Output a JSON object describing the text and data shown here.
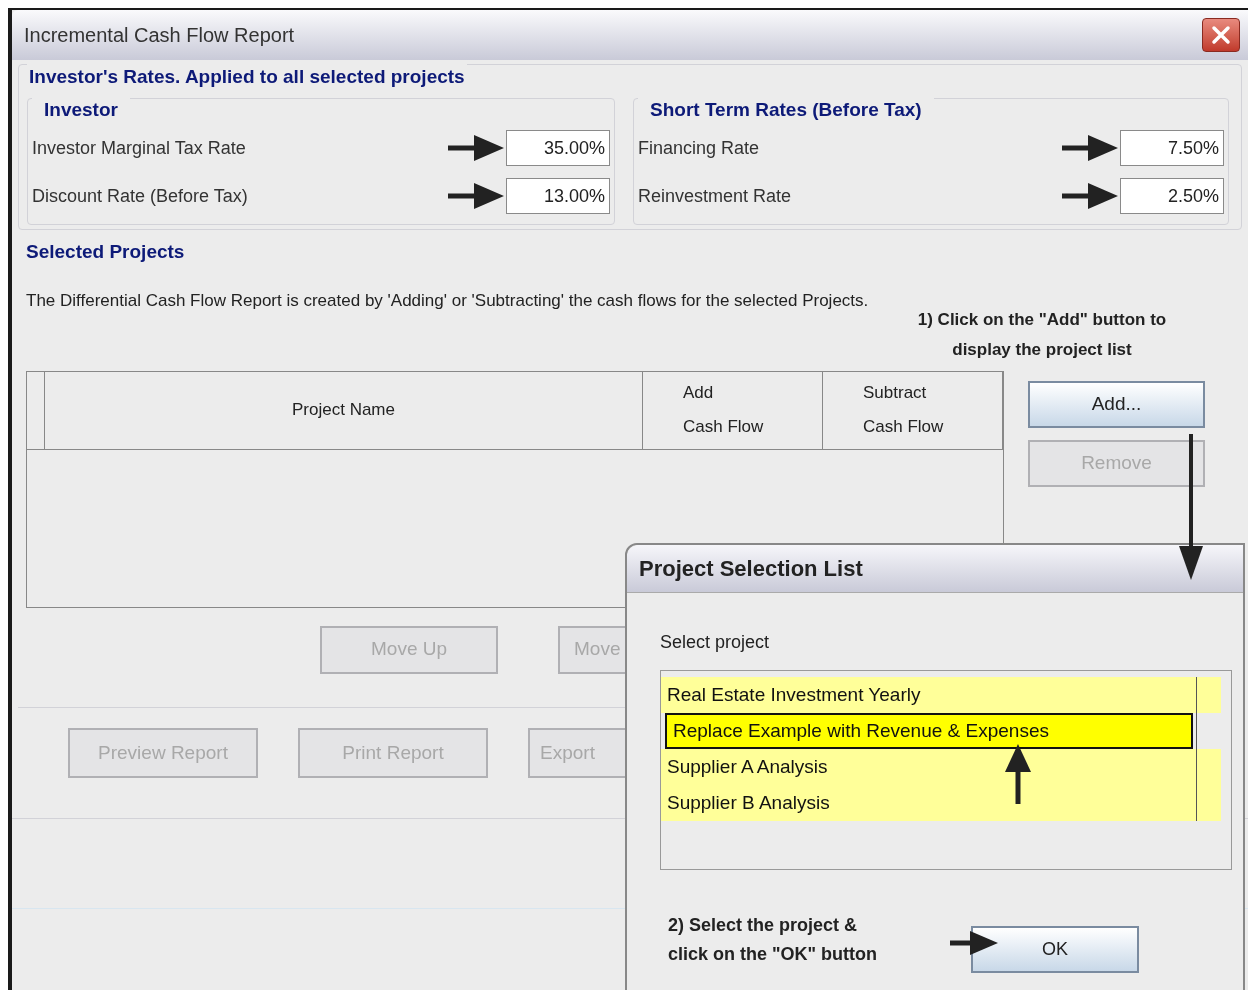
{
  "window": {
    "title": "Incremental Cash Flow Report"
  },
  "rates": {
    "title": "Investor's Rates. Applied to all selected projects",
    "groups": [
      {
        "title": "Investor",
        "fields": [
          {
            "label": "Investor Marginal Tax Rate",
            "value": "35.00%",
            "pointed": true
          },
          {
            "label": "Discount Rate (Before Tax)",
            "value": "13.00%",
            "pointed": true
          }
        ]
      },
      {
        "title": "Short Term Rates (Before Tax)",
        "fields": [
          {
            "label": "Financing Rate",
            "value": "7.50%",
            "pointed": true
          },
          {
            "label": "Reinvestment Rate",
            "value": "2.50%",
            "pointed": true
          }
        ]
      }
    ]
  },
  "selected_projects": {
    "title": "Selected Projects",
    "description": "The Differential Cash Flow Report is created by 'Adding' or 'Subtracting' the cash flows for the selected Projects.",
    "hint": "1) Click on the \"Add\" button to\ndisplay the project list",
    "table": {
      "columns": [
        "Project Name",
        "Add\nCash Flow",
        "Subtract\nCash Flow"
      ]
    },
    "side_buttons": [
      {
        "label": "Add...",
        "disabled": false
      },
      {
        "label": "Remove",
        "disabled": true
      }
    ],
    "move_buttons": [
      {
        "label": "Move Up",
        "disabled": true
      },
      {
        "label": "Move",
        "disabled": true
      }
    ]
  },
  "bottom_buttons": [
    {
      "label": "Preview Report",
      "disabled": true
    },
    {
      "label": "Print Report",
      "disabled": true
    },
    {
      "label": "Export",
      "disabled": true
    }
  ],
  "dialog": {
    "title": "Project Selection List",
    "label": "Select project",
    "items": [
      {
        "label": "Real Estate Investment Yearly",
        "selected": false
      },
      {
        "label": "Replace Example with Revenue & Expenses",
        "selected": true
      },
      {
        "label": "Supplier A  Analysis",
        "selected": false
      },
      {
        "label": "Supplier B Analysis",
        "selected": false
      }
    ],
    "hint": "2) Select the project &\nclick on the \"OK\" button",
    "ok_button": "OK"
  }
}
